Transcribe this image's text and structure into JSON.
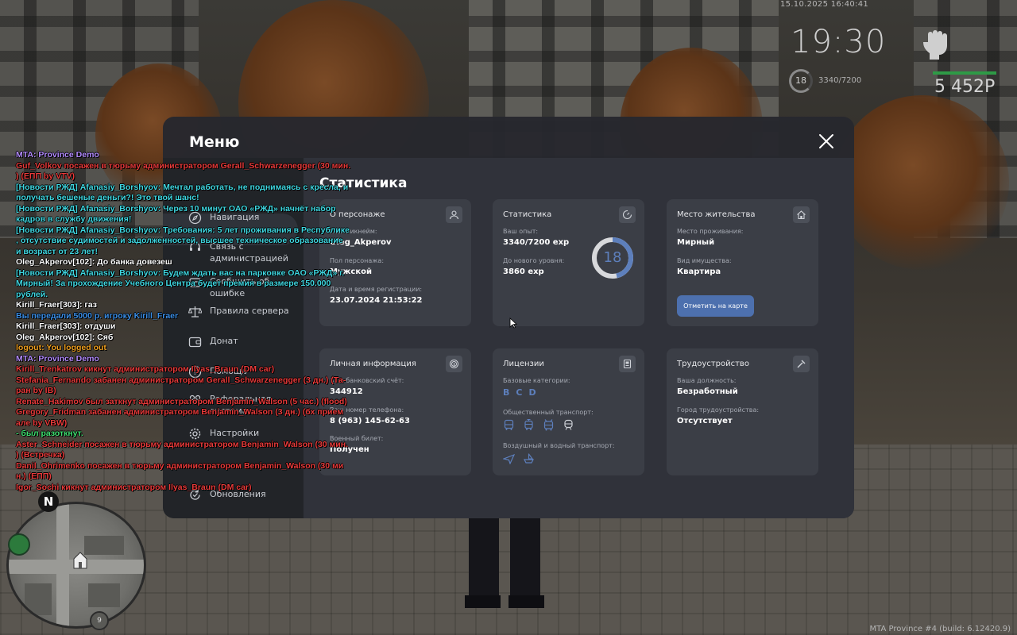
{
  "hud": {
    "date": "15.10.2025 16:40:41",
    "time": "19:30",
    "level": "18",
    "exp": "3340/7200",
    "money": "5 452Р"
  },
  "menu": {
    "title": "Меню",
    "section_title": "Статистика",
    "sidebar": [
      {
        "label": "Навигация",
        "icon": "compass-icon"
      },
      {
        "label": "Связь с администрацией",
        "icon": "headset-icon"
      },
      {
        "label": "Сообщить об ошибке",
        "icon": "bug-icon"
      },
      {
        "label": "Правила сервера",
        "icon": "scales-icon"
      },
      {
        "label": "Донат",
        "icon": "wallet-icon"
      },
      {
        "label": "Помощь",
        "icon": "help-icon"
      },
      {
        "label": "Реферальная система",
        "icon": "referral-icon"
      },
      {
        "label": "Настройки",
        "icon": "gear-icon"
      },
      {
        "label": "Обновления",
        "icon": "refresh-icon"
      }
    ]
  },
  "cards": {
    "character": {
      "title": "О персонаже",
      "nick_label": "Ваш никнейм:",
      "nick": "Oleg_Akperov",
      "gender_label": "Пол персонажа:",
      "gender": "Мужской",
      "reg_label": "Дата и время регистрации:",
      "reg": "23.07.2024 21:53:22"
    },
    "stats": {
      "title": "Статистика",
      "exp_label": "Ваш опыт:",
      "exp": "3340/7200 exp",
      "next_label": "До нового уровня:",
      "next": "3860 exp",
      "level": "18",
      "progress": 0.464
    },
    "residence": {
      "title": "Место жительства",
      "place_label": "Место проживания:",
      "place": "Мирный",
      "property_label": "Вид имущества:",
      "property": "Квартира",
      "map_button": "Отметить на карте"
    },
    "personal": {
      "title": "Личная информация",
      "bank_label": "Ваш банковский счёт:",
      "bank": "344912",
      "phone_label": "Ваш номер телефона:",
      "phone": "8 (963) 145-62-63",
      "military_label": "Военный билет:",
      "military": "Получен"
    },
    "licenses": {
      "title": "Лицензии",
      "base_label": "Базовые категории:",
      "categories": [
        "B",
        "C",
        "D"
      ],
      "public_label": "Общественный транспорт:",
      "air_label": "Воздушный и водный транспорт:"
    },
    "employment": {
      "title": "Трудоустройство",
      "position_label": "Ваша должность:",
      "position": "Безработный",
      "city_label": "Город трудоустройства:",
      "city": "Отсутствует"
    }
  },
  "chat": [
    {
      "text": "MTA: Province Demo",
      "color": "#b48cff"
    },
    {
      "text": "Guf_Volkov посажен в тюрьму администратором Gerall_Schwarzenegger (30 мин.",
      "color": "#e83a3a"
    },
    {
      "text": ") (ЕПП by VTV)",
      "color": "#e83a3a"
    },
    {
      "text": "[Новости РЖД] Afanasiy_Borshyov: Мечтал работать, не поднимаясь с кресла, и",
      "color": "#3fd6e0"
    },
    {
      "text": "получать бешеные деньги?! Это твой шанс!",
      "color": "#3fd6e0"
    },
    {
      "text": "[Новости РЖД] Afanasiy_Borshyov: Через 10 минут ОАО «РЖД» начнёт набор",
      "color": "#3fd6e0"
    },
    {
      "text": "кадров в службу движения!",
      "color": "#3fd6e0"
    },
    {
      "text": "[Новости РЖД] Afanasiy_Borshyov: Требования: 5 лет проживания в Республике",
      "color": "#3fd6e0"
    },
    {
      "text": ", отсутствие судимостей и задолженностей, высшее техническое образование",
      "color": "#3fd6e0"
    },
    {
      "text": " и возраст от 23 лет!",
      "color": "#3fd6e0"
    },
    {
      "text": "Oleg_Akperov[102]: До банка довезеш",
      "color": "#ffffff"
    },
    {
      "text": "[Новости РЖД] Afanasiy_Borshyov: Будем ждать вас на парковке ОАО «РЖД» г.",
      "color": "#3fd6e0"
    },
    {
      "text": " Мирный! За прохождение Учебного Центра будет премия в размере 150.000",
      "color": "#3fd6e0"
    },
    {
      "text": "рублей.",
      "color": "#3fd6e0"
    },
    {
      "text": "Kirill_Fraer[303]: газ",
      "color": "#ffffff"
    },
    {
      "text": "Вы передали 5000 р. игроку Kirill_Fraer",
      "color": "#3b8fe8"
    },
    {
      "text": "Kirill_Fraer[303]: отдуши",
      "color": "#ffffff"
    },
    {
      "text": "Oleg_Akperov[102]: Сяб",
      "color": "#ffffff"
    },
    {
      "text": "logout: You logged out",
      "color": "#f0a020"
    },
    {
      "text": "MTA: Province Demo",
      "color": "#b48cff"
    },
    {
      "text": "Kirill_Trenkatrov кикнут администратором Ilyas_Braun (DM car)",
      "color": "#e83a3a"
    },
    {
      "text": "Stefania_Fernando забанен администратором Gerall_Schwarzenegger (3 дн.) (Та-",
      "color": "#e83a3a"
    },
    {
      "text": "ран by IB)",
      "color": "#e83a3a"
    },
    {
      "text": "Renate_Hakimov был заткнут администратором Benjamin_Walson (5 час.) (flood)",
      "color": "#e83a3a"
    },
    {
      "text": "Gregory_Fridman забанен администратором Benjamin_Walson (3 дн.) (бх прием",
      "color": "#e83a3a"
    },
    {
      "text": "але by VBW)",
      "color": "#e83a3a"
    },
    {
      "text": " - был разоткнут.",
      "color": "#3fe070"
    },
    {
      "text": "Aster_Schneider посажен в тюрьму администратором Benjamin_Walson (30 мин.",
      "color": "#e83a3a"
    },
    {
      "text": ") (Встречка)",
      "color": "#e83a3a"
    },
    {
      "text": "Danil_Ohrimenko посажен в тюрьму администратором Benjamin_Walson (30 ми",
      "color": "#e83a3a"
    },
    {
      "text": "н.) (ЕПП)",
      "color": "#e83a3a"
    },
    {
      "text": "Igor_Sochi кикнут администратором Ilyas_Braun (DM car)",
      "color": "#e83a3a"
    }
  ],
  "minimap": {
    "north": "N",
    "badge": "9"
  },
  "version": "MTA Province #4 (build: 6.12420.9)"
}
